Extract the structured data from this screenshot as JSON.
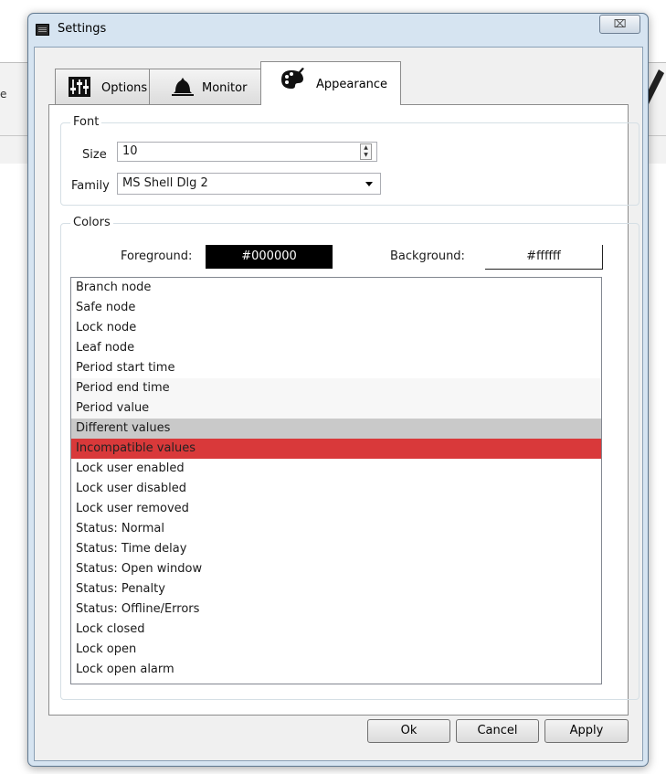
{
  "background": {
    "fragment_text": "e"
  },
  "window": {
    "title": "Settings",
    "close_glyph": "⌧"
  },
  "tabs": [
    {
      "label": "Options",
      "icon": "sliders-icon"
    },
    {
      "label": "Monitor",
      "icon": "bell-icon"
    },
    {
      "label": "Appearance",
      "icon": "palette-brush-icon",
      "active": true
    }
  ],
  "font_group": {
    "legend": "Font",
    "size_label": "Size",
    "size_value": "10",
    "family_label": "Family",
    "family_value": "MS Shell Dlg 2"
  },
  "colors_group": {
    "legend": "Colors",
    "foreground_label": "Foreground:",
    "foreground_value": "#000000",
    "background_label": "Background:",
    "background_value": "#ffffff"
  },
  "list_items": [
    "Branch node",
    "Safe node",
    "Lock node",
    "Leaf node",
    "Period start time",
    "Period end time",
    "Period value",
    "Different values",
    "Incompatible values",
    "Lock user enabled",
    "Lock user disabled",
    "Lock user removed",
    "Status: Normal",
    "Status: Time delay",
    "Status: Open window",
    "Status: Penalty",
    "Status: Offline/Errors",
    "Lock closed",
    "Lock open",
    "Lock open alarm"
  ],
  "buttons": {
    "ok": "Ok",
    "cancel": "Cancel",
    "apply": "Apply"
  },
  "colors": {
    "window_frame": "#d6e4f1",
    "selection_gray": "#c9c9c9",
    "selection_red": "#d9393a"
  }
}
